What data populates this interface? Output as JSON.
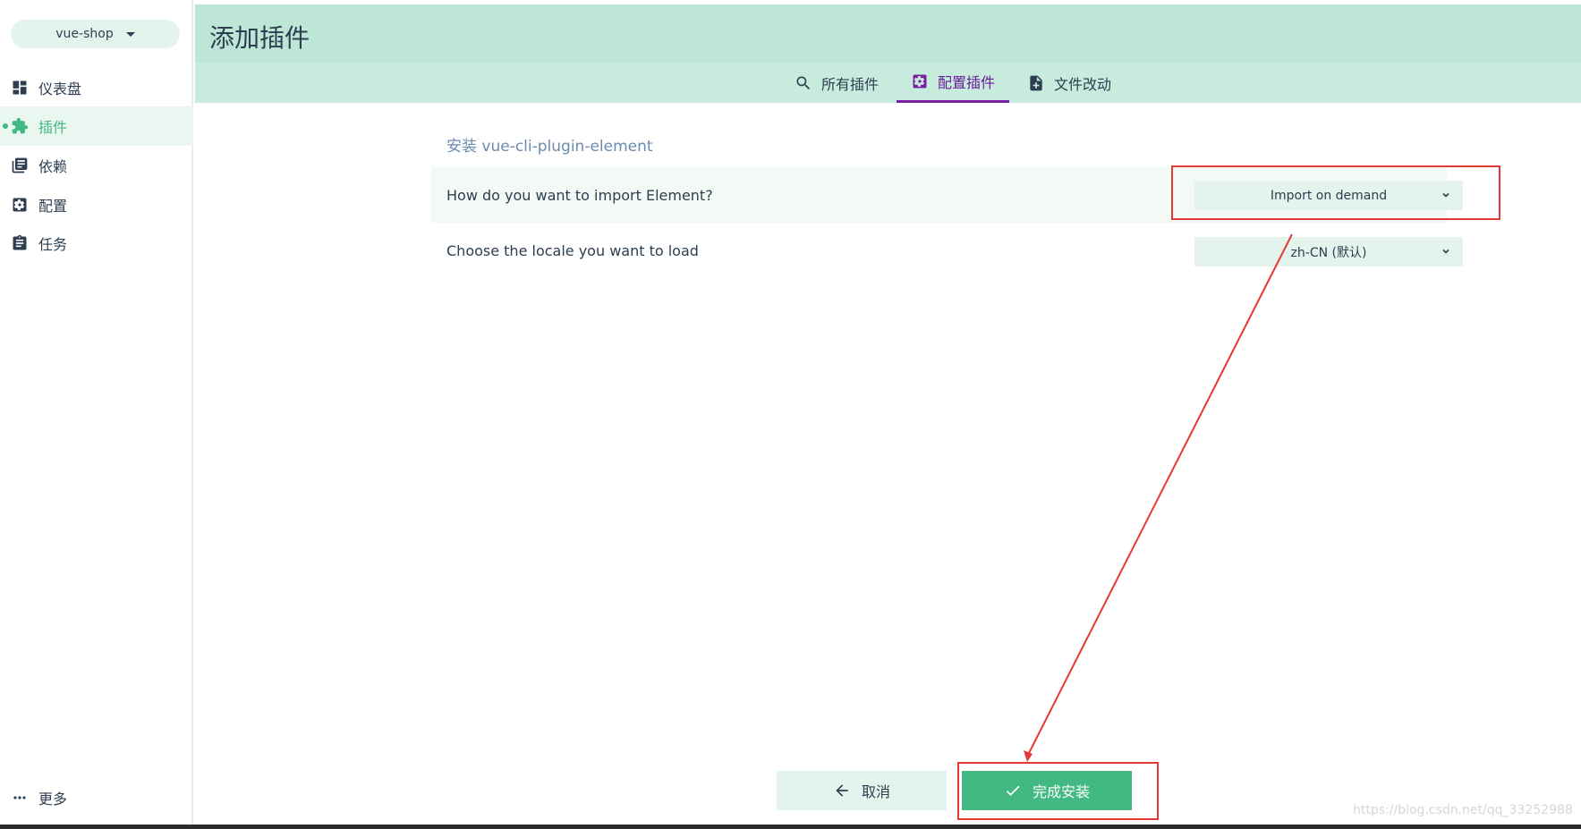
{
  "sidebar": {
    "project": "vue-shop",
    "items": [
      {
        "label": "仪表盘",
        "icon": "dashboard-icon"
      },
      {
        "label": "插件",
        "icon": "puzzle-icon"
      },
      {
        "label": "依赖",
        "icon": "library-books-icon"
      },
      {
        "label": "配置",
        "icon": "settings-icon"
      },
      {
        "label": "任务",
        "icon": "assignment-icon"
      }
    ],
    "active_index": 1,
    "more_label": "更多"
  },
  "header": {
    "title": "添加插件",
    "tabs": [
      {
        "label": "所有插件",
        "icon": "search-icon"
      },
      {
        "label": "配置插件",
        "icon": "settings-icon"
      },
      {
        "label": "文件改动",
        "icon": "file-diff-icon"
      }
    ],
    "active_tab": 1
  },
  "main": {
    "section_title": "安装 vue-cli-plugin-element",
    "prompts": [
      {
        "question": "How do you want to import Element?",
        "value": "Import on demand"
      },
      {
        "question": "Choose the locale you want to load",
        "value": "zh-CN (默认)"
      }
    ]
  },
  "footer": {
    "cancel_label": "取消",
    "finish_label": "完成安装"
  },
  "watermark": "https://blog.csdn.net/qq_33252988",
  "colors": {
    "accent": "#42b983",
    "header_bg": "#bde6d6",
    "active_tab": "#7b1fa2",
    "annotation": "#e53935"
  }
}
